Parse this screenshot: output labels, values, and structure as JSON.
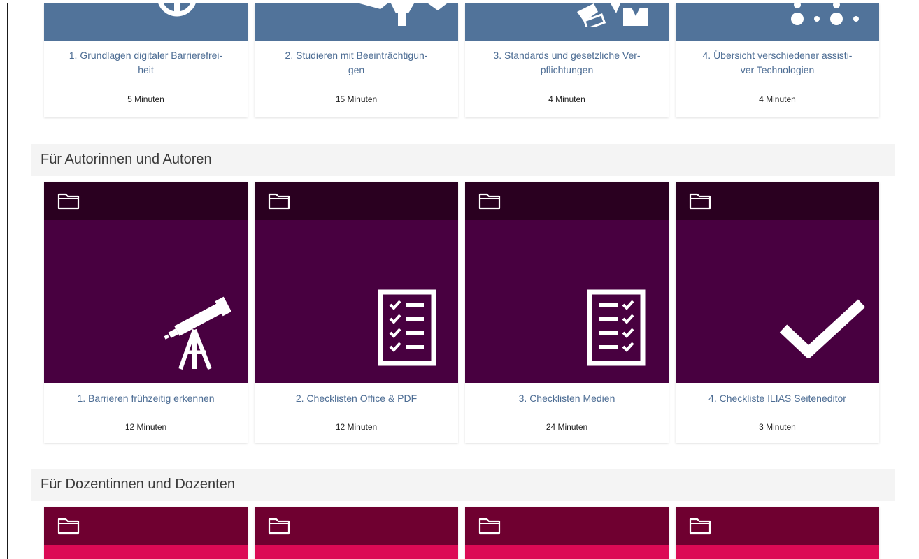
{
  "colors": {
    "top_card_bg": "#51739a",
    "author_band": "#2a0020",
    "author_body": "#480040",
    "lecturer_band": "#6f0030",
    "lecturer_body": "#dc0a55",
    "link_text": "#4d6d94"
  },
  "top_row": {
    "cards": [
      {
        "title": "1. Grundlagen digitaler Barrierefrei-heit",
        "title_line1": "1. Grundlagen digitaler Barrierefrei-",
        "title_line2": "heit",
        "duration": "5 Minuten",
        "icon": "accessibility-icon"
      },
      {
        "title": "2. Studieren mit Beeinträchtigungen",
        "title_line1": "2. Studieren mit Beeinträchtigun-",
        "title_line2": "gen",
        "duration": "15 Minuten",
        "icon": "graduation-icon"
      },
      {
        "title": "3. Standards und gesetzliche Verpflichtungen",
        "title_line1": "3. Standards und gesetzliche Ver-",
        "title_line2": "pflichtungen",
        "duration": "4 Minuten",
        "icon": "gavel-icon"
      },
      {
        "title": "4. Übersicht verschiedener assistiver Technologien",
        "title_line1": "4. Übersicht verschiedener assisti-",
        "title_line2": "ver Technologien",
        "duration": "4 Minuten",
        "icon": "braille-icon"
      }
    ]
  },
  "sections": [
    {
      "title": "Für Autorinnen und Autoren",
      "cards": [
        {
          "title": "1. Barrieren frühzeitig erkennen",
          "duration": "12 Minuten",
          "icon": "telescope-icon"
        },
        {
          "title": "2. Checklisten Office & PDF",
          "duration": "12 Minuten",
          "icon": "checklist-icon"
        },
        {
          "title": "3. Checklisten Medien",
          "duration": "24 Minuten",
          "icon": "checklist-icon"
        },
        {
          "title": "4. Checkliste ILIAS Seiteneditor",
          "duration": "3 Minuten",
          "icon": "checkmark-icon"
        }
      ]
    },
    {
      "title": "Für Dozentinnen und Dozenten",
      "cards": [
        {
          "icon": "folder-icon"
        },
        {
          "icon": "folder-icon"
        },
        {
          "icon": "folder-icon"
        },
        {
          "icon": "folder-icon"
        }
      ]
    }
  ]
}
